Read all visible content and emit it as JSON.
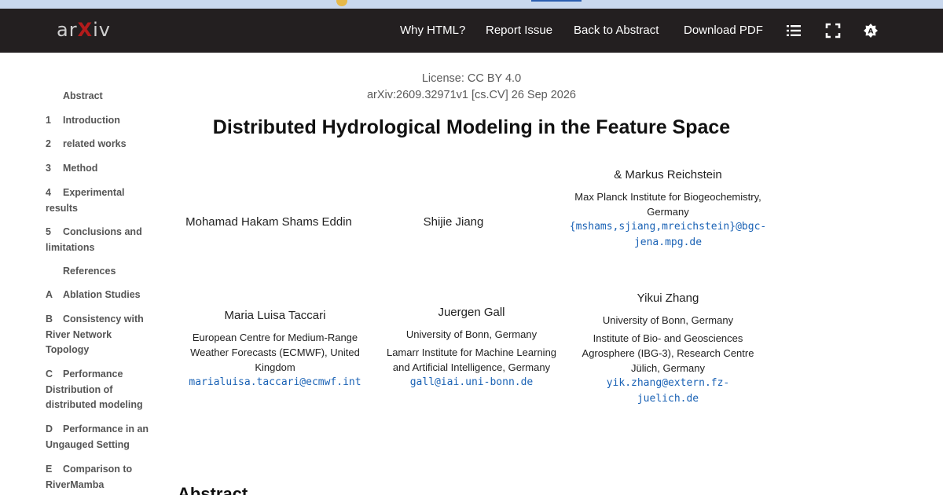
{
  "navbar": {
    "logo": {
      "a": "ar",
      "x": "X",
      "b": "iv"
    },
    "links": [
      "Why HTML?",
      "Report Issue",
      "Back to Abstract",
      "Download PDF"
    ],
    "icons": [
      "list-icon",
      "fullscreen-icon",
      "theme-icon"
    ]
  },
  "toc": [
    {
      "num": "",
      "label": "Abstract"
    },
    {
      "num": "1",
      "label": "Introduction"
    },
    {
      "num": "2",
      "label": "related works"
    },
    {
      "num": "3",
      "label": "Method"
    },
    {
      "num": "4",
      "label": "Experimental results"
    },
    {
      "num": "5",
      "label": "Conclusions and limitations"
    },
    {
      "num": "",
      "label": "References"
    },
    {
      "num": "A",
      "label": "Ablation Studies"
    },
    {
      "num": "B",
      "label": "Consistency with River Network Topology"
    },
    {
      "num": "C",
      "label": "Performance Distribution of distributed modeling"
    },
    {
      "num": "D",
      "label": "Performance in an Ungauged Setting"
    },
    {
      "num": "E",
      "label": "Comparison to RiverMamba"
    }
  ],
  "paper": {
    "license": "License: CC BY 4.0",
    "arxiv_id": "arXiv:2609.32971v1 [cs.CV] 26 Sep 2026",
    "title": "Distributed Hydrological Modeling in the Feature Space",
    "authors": {
      "eddin": {
        "name": "Mohamad Hakam Shams Eddin"
      },
      "jiang": {
        "name": "Shijie Jiang"
      },
      "reichstein": {
        "name": "& Markus Reichstein",
        "affiliation_l1": "Max Planck Institute for Biogeochemistry,",
        "affiliation_l2": "Germany",
        "email_l1": "{mshams,sjiang,mreichstein}@bgc-",
        "email_l2": "jena.mpg.de"
      },
      "taccari": {
        "name": "Maria Luisa Taccari",
        "affiliation_l1": "European Centre for Medium-Range",
        "affiliation_l2": "Weather Forecasts (ECMWF), United",
        "affiliation_l3": "Kingdom",
        "email": "marialuisa.taccari@ecmwf.int"
      },
      "gall": {
        "name": "Juergen Gall",
        "affiliation1": "University of Bonn, Germany",
        "affiliation2_l1": "Lamarr Institute for Machine Learning",
        "affiliation2_l2": "and Artificial Intelligence, Germany",
        "email": "gall@iai.uni-bonn.de"
      },
      "zhang": {
        "name": "Yikui Zhang",
        "affiliation1": "University of Bonn, Germany",
        "affiliation2_l1": "Institute of Bio- and Geosciences",
        "affiliation2_l2": "Agrosphere (IBG-3), Research Centre",
        "affiliation2_l3": "Jülich, Germany",
        "email_l1": "yik.zhang@extern.fz-",
        "email_l2": "juelich.de"
      }
    },
    "abstract_heading": "Abstract"
  }
}
